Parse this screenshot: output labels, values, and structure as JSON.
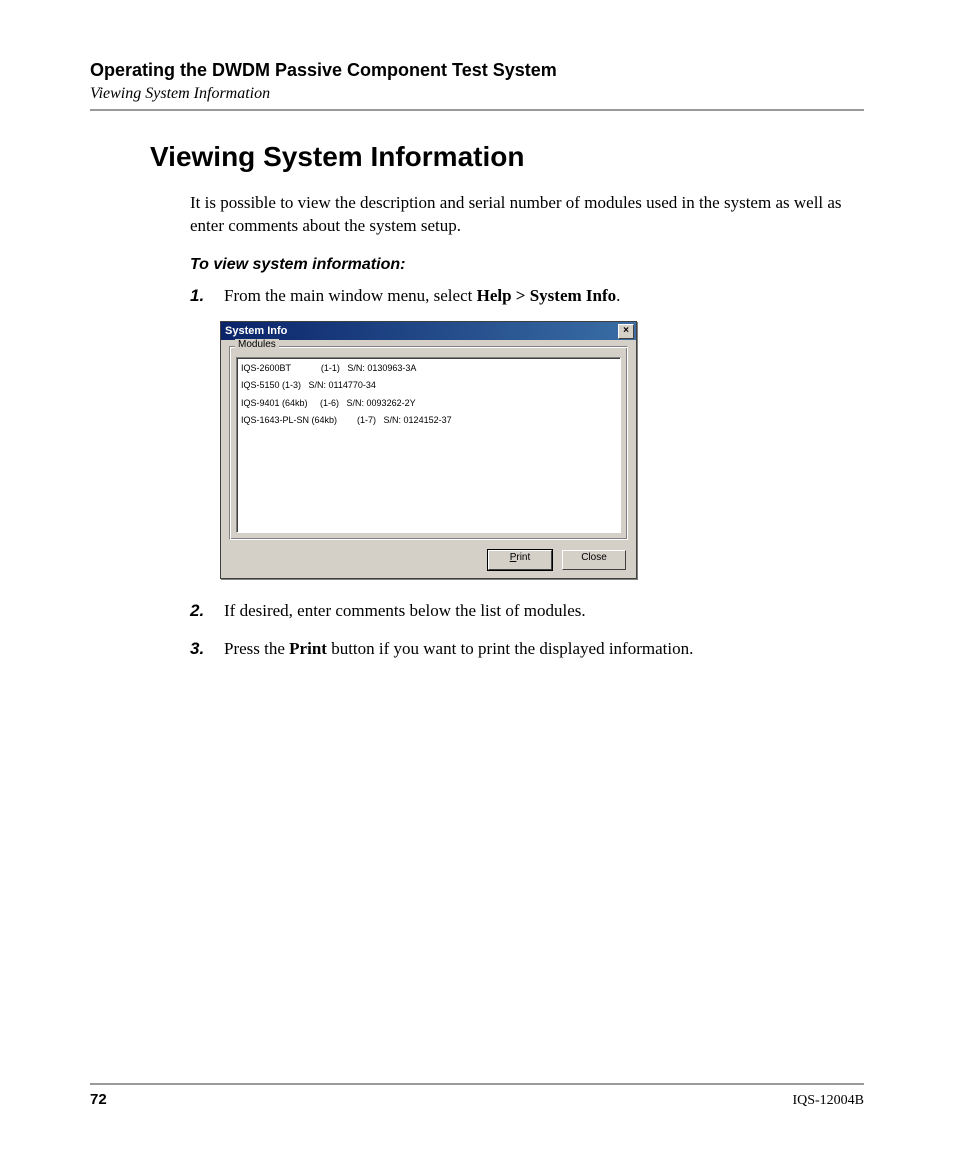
{
  "header": {
    "chapter": "Operating the DWDM Passive Component Test System",
    "section": "Viewing System Information"
  },
  "title": "Viewing System Information",
  "intro": "It is possible to view the description and serial number of modules used in the system as well as enter comments about the system setup.",
  "task_heading": "To view system information:",
  "steps": {
    "s1_num": "1.",
    "s1_a": "From the main window menu, select ",
    "s1_b": "Help > System Info",
    "s1_c": ".",
    "s2_num": "2.",
    "s2": "If desired, enter comments below the list of modules.",
    "s3_num": "3.",
    "s3_a": "Press the ",
    "s3_b": "Print",
    "s3_c": " button if you want to print the displayed information."
  },
  "dialog": {
    "title": "System Info",
    "close_glyph": "×",
    "group_label": "Modules",
    "rows": [
      "IQS-2600BT            (1-1)   S/N: 0130963-3A",
      "IQS-5150 (1-3)   S/N: 0114770-34",
      "IQS-9401 (64kb)     (1-6)   S/N: 0093262-2Y",
      "IQS-1643-PL-SN (64kb)        (1-7)   S/N: 0124152-37"
    ],
    "buttons": {
      "print_u": "P",
      "print_rest": "rint",
      "close": "Close"
    }
  },
  "footer": {
    "page": "72",
    "docid": "IQS-12004B"
  }
}
